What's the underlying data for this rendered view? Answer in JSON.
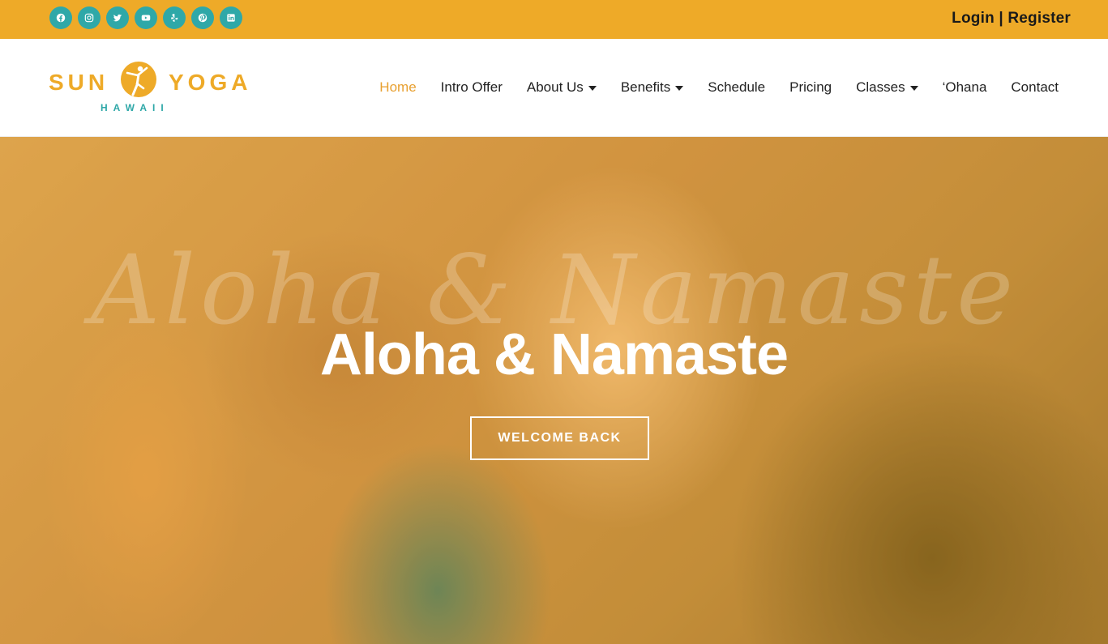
{
  "colors": {
    "topbar": "#EEAA28",
    "social_bg": "#2FA8A8",
    "nav_active": "#E8A030"
  },
  "topbar": {
    "social": [
      {
        "name": "facebook-icon"
      },
      {
        "name": "instagram-icon"
      },
      {
        "name": "twitter-icon"
      },
      {
        "name": "youtube-icon"
      },
      {
        "name": "yelp-icon"
      },
      {
        "name": "pinterest-icon"
      },
      {
        "name": "linkedin-icon"
      }
    ],
    "login": "Login",
    "separator": " | ",
    "register": "Register"
  },
  "logo": {
    "word1": "SUN",
    "word2": "YOGA",
    "subtitle": "HAWAII"
  },
  "nav": {
    "items": [
      {
        "label": "Home",
        "active": true
      },
      {
        "label": "Intro Offer"
      },
      {
        "label": "About Us",
        "dropdown": true
      },
      {
        "label": "Benefits",
        "dropdown": true
      },
      {
        "label": "Schedule"
      },
      {
        "label": "Pricing"
      },
      {
        "label": "Classes",
        "dropdown": true
      },
      {
        "label": "‘Ohana"
      },
      {
        "label": "Contact"
      }
    ]
  },
  "hero": {
    "watermark": "Aloha & Namaste",
    "title": "Aloha & Namaste",
    "cta": "WELCOME BACK"
  }
}
